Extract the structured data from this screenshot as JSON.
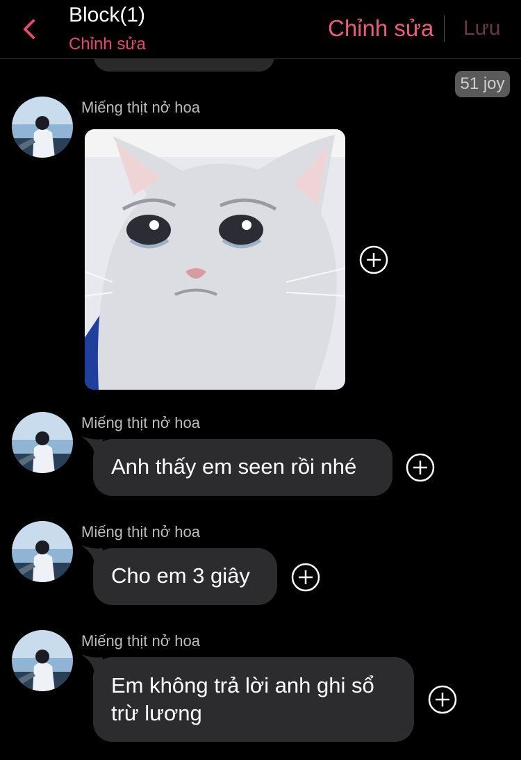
{
  "header": {
    "title": "Block(1)",
    "subtitle": "Chỉnh sửa",
    "edit_label": "Chỉnh sửa",
    "save_label": "Lưu"
  },
  "badge": {
    "label": "51 joy"
  },
  "messages": [
    {
      "sender": "Miếng thịt nở hoa",
      "type": "image",
      "image": "crying-cat-meme"
    },
    {
      "sender": "Miếng thịt nở hoa",
      "type": "text",
      "text": "Anh thấy em seen rồi nhé"
    },
    {
      "sender": "Miếng thịt nở hoa",
      "type": "text",
      "text": "Cho em 3 giây"
    },
    {
      "sender": "Miếng thịt nở hoa",
      "type": "text",
      "line1": "Em không trả lời anh ghi sổ",
      "line2": "trừ lương"
    }
  ],
  "colors": {
    "accent": "#ee5a7a",
    "bubble": "#2c2c2e",
    "background": "#000000"
  }
}
